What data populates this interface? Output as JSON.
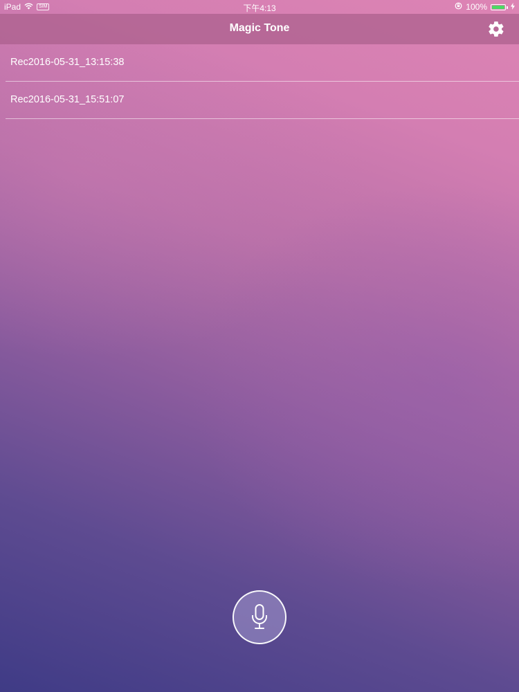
{
  "status_bar": {
    "device": "iPad",
    "time": "下午4:13",
    "battery_percent": "100%",
    "battery_level": 1.0,
    "sim_label": "SIM",
    "icons": [
      "wifi-icon",
      "sim-card-icon",
      "rotation-lock-icon",
      "battery-icon",
      "charging-bolt-icon"
    ]
  },
  "navbar": {
    "title": "Magic Tone",
    "settings_icon": "gear-icon"
  },
  "recordings": [
    {
      "label": "Rec2016-05-31_13:15:38"
    },
    {
      "label": "Rec2016-05-31_15:51:07"
    }
  ],
  "mic_button": {
    "icon": "microphone-icon"
  },
  "colors": {
    "background_top": "#dd84b4",
    "background_bottom": "#3f3b86",
    "navbar": "#aa5f8c",
    "battery_fill": "#4cd964",
    "text": "#ffffff"
  }
}
